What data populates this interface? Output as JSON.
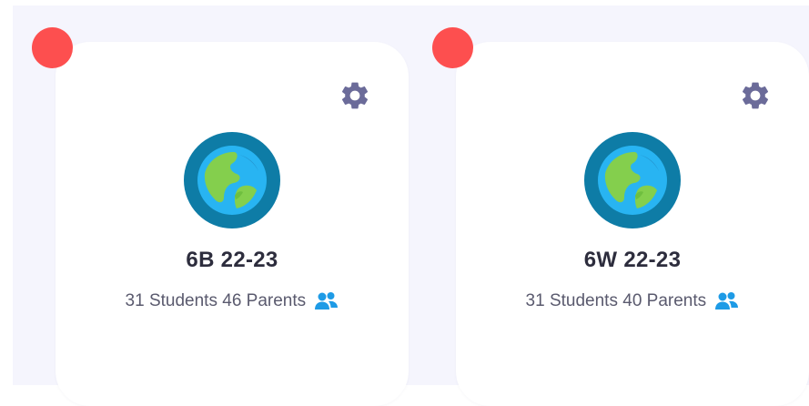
{
  "colors": {
    "background": "#f5f5fd",
    "card": "#ffffff",
    "status_dot": "#fd4f4f",
    "gear": "#6b6b99",
    "accent_blue": "#1e9be6"
  },
  "classes": [
    {
      "name": "6B 22-23",
      "students": "31 Students",
      "parents": "46 Parents",
      "avatar_icon": "globe-icon",
      "settings_icon": "gear-icon",
      "connections_icon": "people-icon"
    },
    {
      "name": "6W 22-23",
      "students": "31 Students",
      "parents": "40 Parents",
      "avatar_icon": "globe-icon",
      "settings_icon": "gear-icon",
      "connections_icon": "people-icon"
    }
  ]
}
